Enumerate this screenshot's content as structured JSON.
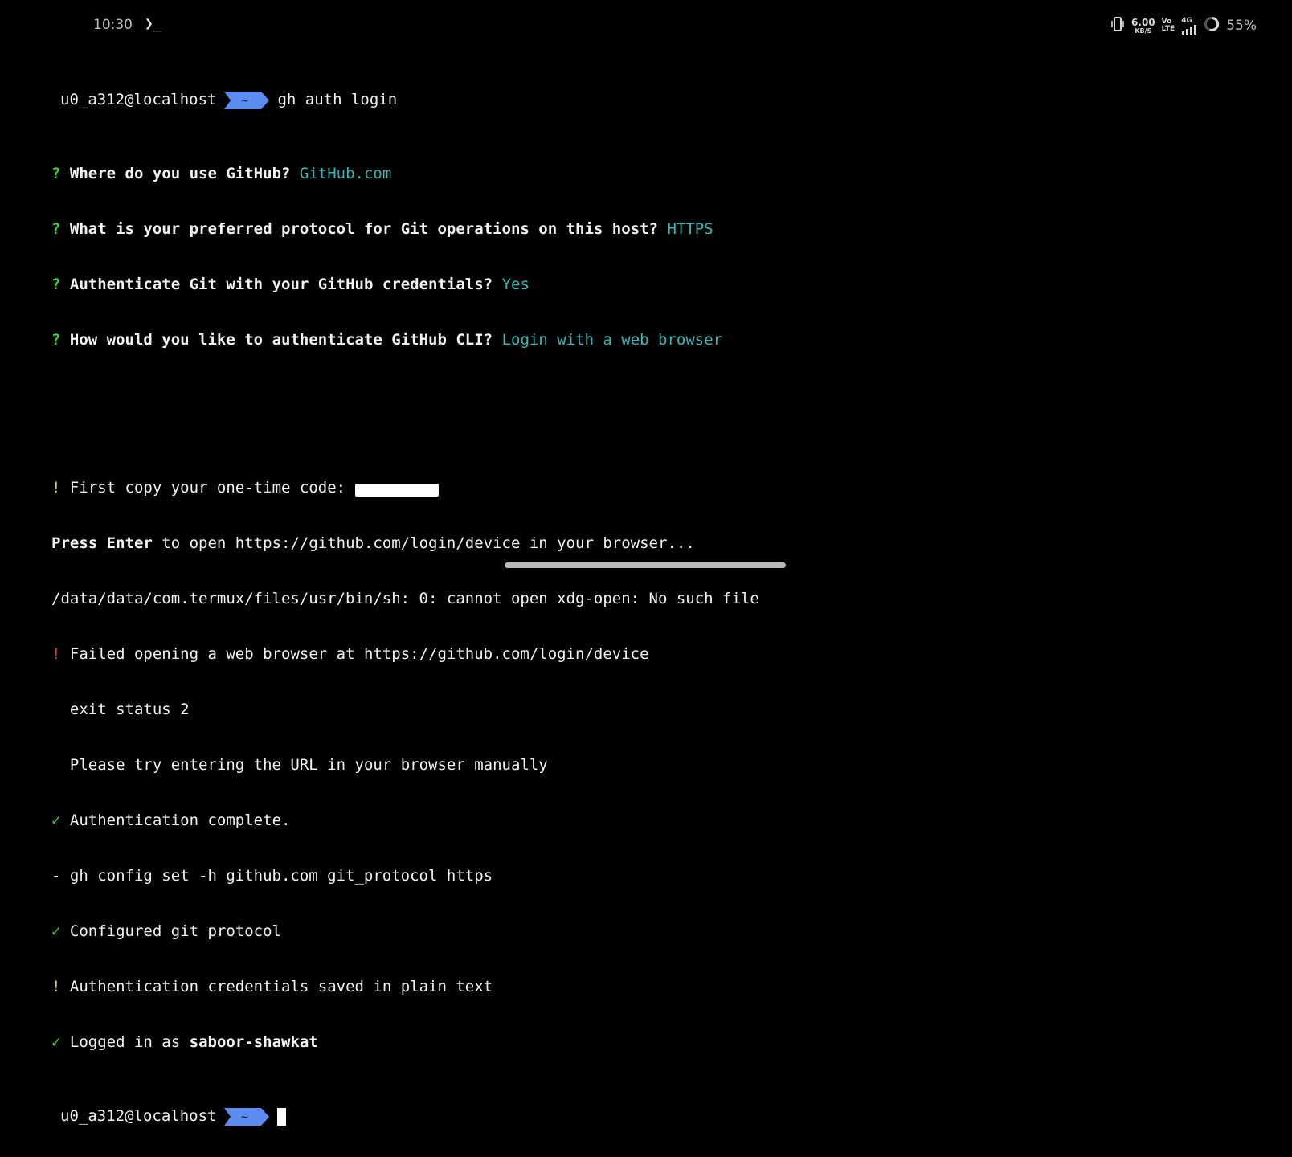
{
  "statusbar": {
    "time": "10:30",
    "termux_glyph": "❯_",
    "net_speed_value": "6.00",
    "net_speed_unit": "KB/S",
    "volte_top": "Vo",
    "volte_bottom": "LTE",
    "network_label": "4G",
    "battery_percent": "55%",
    "icons": [
      "vibrate-icon",
      "signal-icon",
      "battery-ring-icon"
    ]
  },
  "terminal": {
    "prompt_user": "u0_a312@localhost",
    "prompt_dir": "~",
    "prompt_color": "#5b8cf0",
    "command": "gh auth login",
    "q1_mark": "?",
    "q1_text": "Where do you use GitHub?",
    "q1_answer": "GitHub.com",
    "q2_mark": "?",
    "q2_text": "What is your preferred protocol for Git operations on this host?",
    "q2_answer": "HTTPS",
    "q3_mark": "?",
    "q3_text": "Authenticate Git with your GitHub credentials?",
    "q3_answer": "Yes",
    "q4_mark": "?",
    "q4_text": "How would you like to authenticate GitHub CLI?",
    "q4_answer": "Login with a web browser",
    "copy_mark": "!",
    "copy_text": "First copy your one-time code:",
    "press_enter_bold": "Press Enter",
    "press_enter_rest": "to open https://github.com/login/device in your browser...",
    "xdg_error": "/data/data/com.termux/files/usr/bin/sh: 0: cannot open xdg-open: No such file",
    "fail_mark": "!",
    "fail_text": "Failed opening a web browser at https://github.com/login/device",
    "exit_status": "exit status 2",
    "try_manual": "Please try entering the URL in your browser manually",
    "auth_complete_mark": "✓",
    "auth_complete_text": "Authentication complete.",
    "config_line": "- gh config set -h github.com git_protocol https",
    "configured_mark": "✓",
    "configured_text": "Configured git protocol",
    "plain_mark": "!",
    "plain_text": "Authentication credentials saved in plain text",
    "logged_mark": "✓",
    "logged_text": "Logged in as",
    "logged_user": "saboor-shawkat"
  }
}
